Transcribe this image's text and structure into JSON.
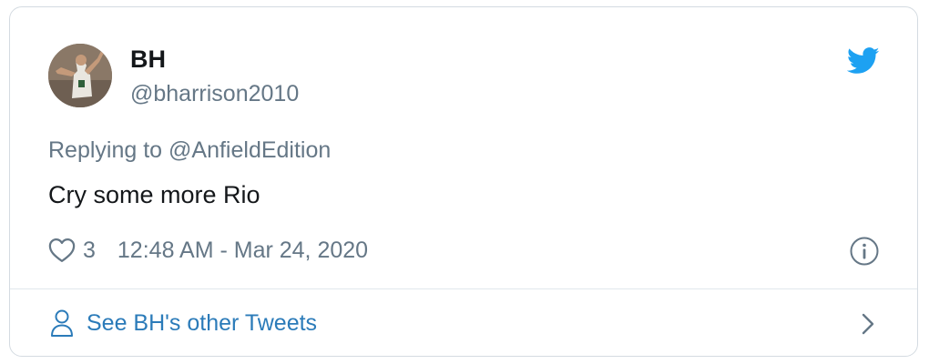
{
  "tweet": {
    "display_name": "BH",
    "handle": "@bharrison2010",
    "reply_prefix": "Replying to",
    "reply_to": "@AnfieldEdition",
    "text": "Cry some more Rio",
    "likes": "3",
    "timestamp": "12:48 AM - Mar 24, 2020"
  },
  "footer": {
    "link_label": "See BH's other Tweets"
  },
  "icons": {
    "logo": "twitter-bird-icon",
    "like": "heart-icon",
    "info": "info-icon",
    "user": "user-icon",
    "chevron": "chevron-right-icon"
  },
  "colors": {
    "brand": "#1da1f2",
    "link": "#2b7bb9",
    "muted": "#657786",
    "text": "#14171a",
    "border": "#e1e8ed"
  }
}
